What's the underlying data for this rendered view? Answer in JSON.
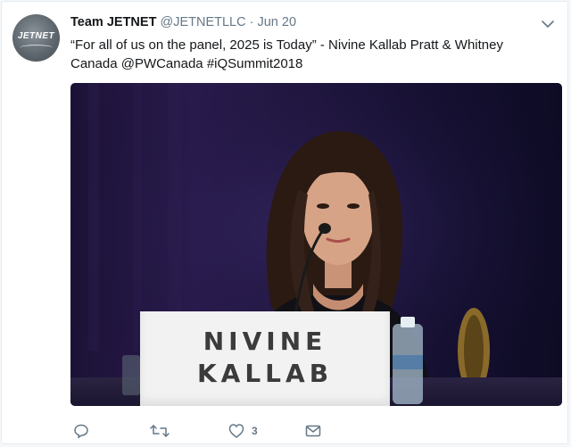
{
  "tweet": {
    "display_name": "Team JETNET",
    "handle": "@JETNETLLC",
    "separator": "·",
    "date": "Jun 20",
    "text_line1": "“For all of us on the panel, 2025 is Today” - Nivine Kallab Pratt & Whitney",
    "text_line2": "Canada @PWCanada #iQSummit2018",
    "avatar_text": "JETNET",
    "media": {
      "nameplate_line1": "NIVINE",
      "nameplate_line2": "KALLAB"
    },
    "actions": {
      "reply_icon": "reply-icon",
      "retweet_icon": "retweet-icon",
      "like_icon": "heart-icon",
      "like_count": "3",
      "message_icon": "envelope-icon"
    }
  }
}
